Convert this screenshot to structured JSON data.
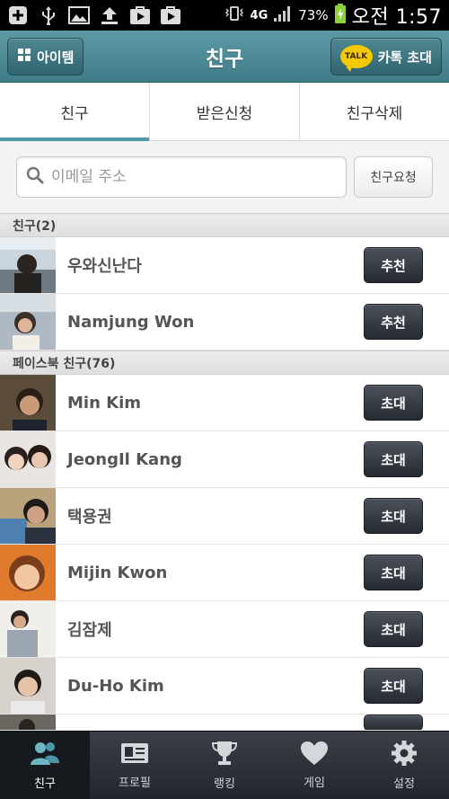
{
  "status_bar": {
    "network": "4G",
    "battery": "73%",
    "time": "오전 1:57"
  },
  "header": {
    "title": "친구",
    "items_button": "아이템",
    "kakao_badge": "TALK",
    "invite_button": "카톡 초대"
  },
  "tabs": [
    {
      "label": "친구",
      "active": true
    },
    {
      "label": "받은신청",
      "active": false
    },
    {
      "label": "친구삭제",
      "active": false
    }
  ],
  "search": {
    "placeholder": "이메일 주소",
    "value": "",
    "request_button": "친구요청"
  },
  "friends_section": {
    "title": "친구(2)",
    "items": [
      {
        "name": "우와신난다",
        "action": "추천"
      },
      {
        "name": "Namjung Won",
        "action": "추천"
      }
    ]
  },
  "facebook_section": {
    "title": "페이스북 친구(76)",
    "items": [
      {
        "name": "Min Kim",
        "action": "초대"
      },
      {
        "name": "JeongIl Kang",
        "action": "초대"
      },
      {
        "name": "택용권",
        "action": "초대"
      },
      {
        "name": "Mijin Kwon",
        "action": "초대"
      },
      {
        "name": "김잠제",
        "action": "초대"
      },
      {
        "name": "Du-Ho Kim",
        "action": "초대"
      }
    ]
  },
  "bottom_nav": [
    {
      "label": "친구",
      "icon": "friends-icon",
      "active": true
    },
    {
      "label": "프로필",
      "icon": "profile-card-icon",
      "active": false
    },
    {
      "label": "랭킹",
      "icon": "trophy-icon",
      "active": false
    },
    {
      "label": "게임",
      "icon": "heart-icon",
      "active": false
    },
    {
      "label": "설정",
      "icon": "gear-icon",
      "active": false
    }
  ],
  "colors": {
    "header": "#4a8a95",
    "tab_indicator": "#4c9aa8",
    "action_button": "#2f343b",
    "nav_bg": "#2c3036"
  }
}
